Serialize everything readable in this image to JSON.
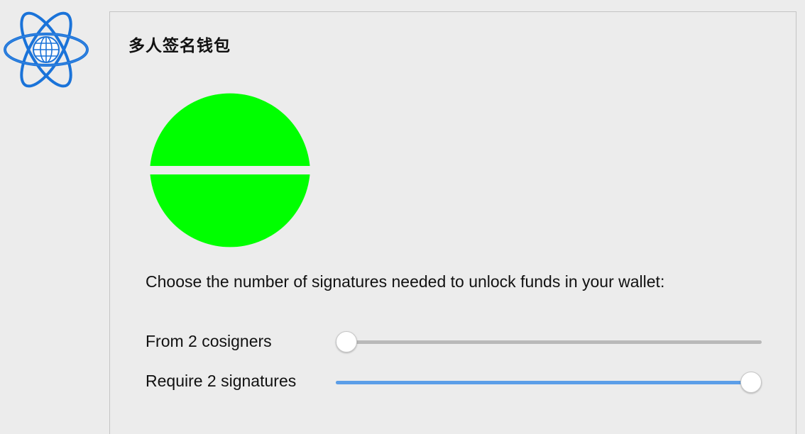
{
  "window": {
    "title": "多人签名钱包"
  },
  "logo": {
    "icon": "electrum-atom-logo-icon",
    "color": "#1a73d9"
  },
  "illustration": {
    "icon": "multisig-pie-icon",
    "color": "#00ff00",
    "segments": 2
  },
  "description": "Choose the number of signatures needed to unlock funds in your wallet:",
  "cosigners": {
    "label": "From 2 cosigners",
    "value": 2,
    "position": 0.0
  },
  "signatures": {
    "label": "Require 2 signatures",
    "value": 2,
    "position": 1.0
  },
  "colors": {
    "accent": "#5b9ee8",
    "track": "#b9b9b9",
    "background": "#ececec"
  }
}
